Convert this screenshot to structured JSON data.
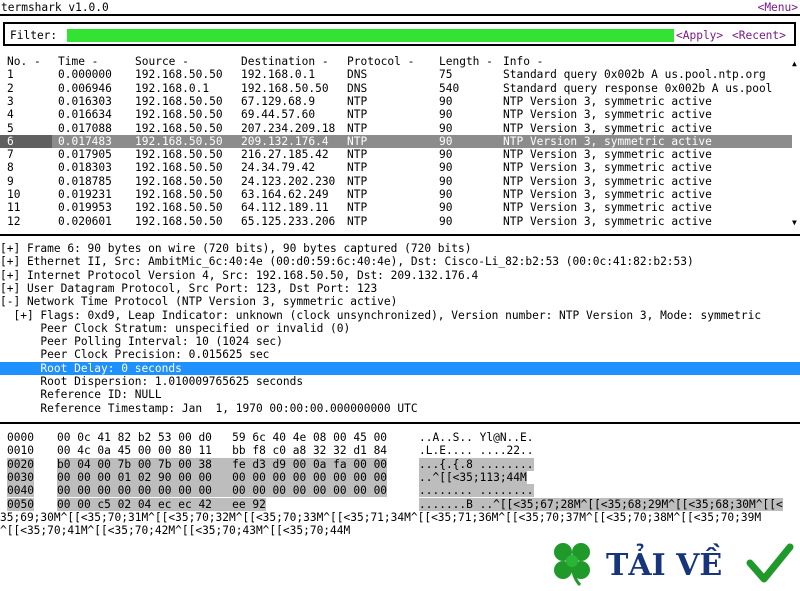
{
  "app": {
    "title": "termshark v1.0.0",
    "menu_label": "<Menu>"
  },
  "filter": {
    "label": "Filter:",
    "value": "",
    "apply_label": "<Apply>",
    "recent_label": "<Recent>"
  },
  "packet_list": {
    "columns": [
      "No. -",
      "Time -",
      "Source -",
      "Destination -",
      "Protocol -",
      "Length -",
      "Info -"
    ],
    "rows": [
      [
        "1",
        "0.000000",
        "192.168.50.50",
        "192.168.0.1",
        "DNS",
        "75",
        "Standard query 0x002b A us.pool.ntp.org"
      ],
      [
        "2",
        "0.006946",
        "192.168.0.1",
        "192.168.50.50",
        "DNS",
        "540",
        "Standard query response 0x002b A us.pool"
      ],
      [
        "3",
        "0.016303",
        "192.168.50.50",
        "67.129.68.9",
        "NTP",
        "90",
        "NTP Version 3, symmetric active"
      ],
      [
        "4",
        "0.016634",
        "192.168.50.50",
        "69.44.57.60",
        "NTP",
        "90",
        "NTP Version 3, symmetric active"
      ],
      [
        "5",
        "0.017088",
        "192.168.50.50",
        "207.234.209.18",
        "NTP",
        "90",
        "NTP Version 3, symmetric active"
      ],
      [
        "6",
        "0.017483",
        "192.168.50.50",
        "209.132.176.4",
        "NTP",
        "90",
        "NTP Version 3, symmetric active"
      ],
      [
        "7",
        "0.017905",
        "192.168.50.50",
        "216.27.185.42",
        "NTP",
        "90",
        "NTP Version 3, symmetric active"
      ],
      [
        "8",
        "0.018303",
        "192.168.50.50",
        "24.34.79.42",
        "NTP",
        "90",
        "NTP Version 3, symmetric active"
      ],
      [
        "9",
        "0.018785",
        "192.168.50.50",
        "24.123.202.230",
        "NTP",
        "90",
        "NTP Version 3, symmetric active"
      ],
      [
        "10",
        "0.019231",
        "192.168.50.50",
        "63.164.62.249",
        "NTP",
        "90",
        "NTP Version 3, symmetric active"
      ],
      [
        "11",
        "0.019953",
        "192.168.50.50",
        "64.112.189.11",
        "NTP",
        "90",
        "NTP Version 3, symmetric active"
      ],
      [
        "12",
        "0.020601",
        "192.168.50.50",
        "65.125.233.206",
        "NTP",
        "90",
        "NTP Version 3, symmetric active"
      ]
    ],
    "selected_index": 5,
    "scroll_up_glyph": "▲",
    "scroll_down_glyph": "▼"
  },
  "details": {
    "lines": [
      "[+] Frame 6: 90 bytes on wire (720 bits), 90 bytes captured (720 bits)",
      "[+] Ethernet II, Src: AmbitMic_6c:40:4e (00:d0:59:6c:40:4e), Dst: Cisco-Li_82:b2:53 (00:0c:41:82:b2:53)",
      "[+] Internet Protocol Version 4, Src: 192.168.50.50, Dst: 209.132.176.4",
      "[+] User Datagram Protocol, Src Port: 123, Dst Port: 123",
      "[-] Network Time Protocol (NTP Version 3, symmetric active)",
      "  [+] Flags: 0xd9, Leap Indicator: unknown (clock unsynchronized), Version number: NTP Version 3, Mode: symmetric",
      "      Peer Clock Stratum: unspecified or invalid (0)",
      "      Peer Polling Interval: 10 (1024 sec)",
      "      Peer Clock Precision: 0.015625 sec",
      "      Root Delay: 0 seconds",
      "      Root Dispersion: 1.010009765625 seconds",
      "      Reference ID: NULL",
      "      Reference Timestamp: Jan  1, 1970 00:00:00.000000000 UTC"
    ],
    "selected_index": 9
  },
  "hex": {
    "offsets": [
      "0000",
      "0010",
      "0020",
      "0030",
      "0040",
      "0050"
    ],
    "bytes": [
      "00 0c 41 82 b2 53 00 d0   59 6c 40 4e 08 00 45 00",
      "00 4c 0a 45 00 00 80 11   bb f8 c0 a8 32 32 d1 84",
      "b0 04 00 7b 00 7b 00 38   fe d3 d9 00 0a fa 00 00",
      "00 00 00 01 02 90 00 00   00 00 00 00 00 00 00 00",
      "00 00 00 00 00 00 00 00   00 00 00 00 00 00 00 00",
      "00 00 c5 02 04 ec ec 42   ee 92"
    ],
    "ascii": [
      "..A..S.. Yl@N..E.",
      ".L.E.... ....22..",
      "...{.{.8 ........",
      "..^[[<35;113;44M",
      "........ ........",
      ".......B ..^[[<35;67;28M^[[<35;68;29M^[[<35;68;30M^[[<"
    ],
    "garbage": [
      "35;69;30M^[[<35;70;31M^[[<35;70;32M^[[<35;70;33M^[[<35;71;34M^[[<35;71;36M^[[<35;70;37M^[[<35;70;38M^[[<35;70;39M",
      "^[[<35;70;41M^[[<35;70;42M^[[<35;70;43M^[[<35;70;44M"
    ]
  },
  "logo": {
    "text": "TẢI VỀ",
    "clover_color": "#1f9a2a",
    "text_color": "#17357a",
    "check_color": "#1f9a2a"
  }
}
